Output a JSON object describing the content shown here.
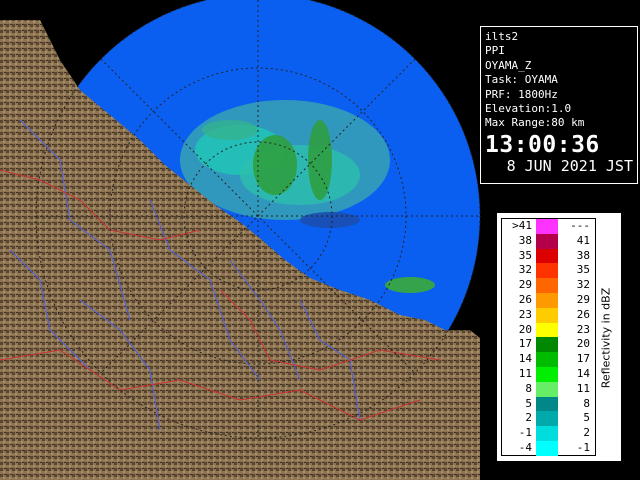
{
  "radar": {
    "site": "ilts2",
    "mode": "PPI",
    "product": "OYAMA_Z",
    "task": "Task: OYAMA",
    "prf": "PRF: 1800Hz",
    "elevation": "Elevation:1.0",
    "max_range": "Max Range:80 km",
    "time": "13:00:36",
    "date": "8 JUN 2021 JST"
  },
  "legend": {
    "unit": "Reflectivity in dBZ",
    "rows": [
      {
        "lo": ">41",
        "hi": "---",
        "color": "#ff33ff"
      },
      {
        "lo": "38",
        "hi": "41",
        "color": "#b4004b"
      },
      {
        "lo": "35",
        "hi": "38",
        "color": "#dd0000"
      },
      {
        "lo": "32",
        "hi": "35",
        "color": "#ff3300"
      },
      {
        "lo": "29",
        "hi": "32",
        "color": "#ff6600"
      },
      {
        "lo": "26",
        "hi": "29",
        "color": "#ff9900"
      },
      {
        "lo": "23",
        "hi": "26",
        "color": "#ffcc00"
      },
      {
        "lo": "20",
        "hi": "23",
        "color": "#ffff00"
      },
      {
        "lo": "17",
        "hi": "20",
        "color": "#008800"
      },
      {
        "lo": "14",
        "hi": "17",
        "color": "#00bb00"
      },
      {
        "lo": "11",
        "hi": "14",
        "color": "#00ee00"
      },
      {
        "lo": "8",
        "hi": "11",
        "color": "#66ee66"
      },
      {
        "lo": "5",
        "hi": "8",
        "color": "#008888"
      },
      {
        "lo": "2",
        "hi": "5",
        "color": "#00aaaa"
      },
      {
        "lo": "-1",
        "hi": "2",
        "color": "#00dddd"
      },
      {
        "lo": "-4",
        "hi": "-1",
        "color": "#00ffff"
      }
    ]
  },
  "colors": {
    "sea": "#0a5ff0",
    "outside": "#000000",
    "land": "#8a7352",
    "rivers": "#4f5fe0",
    "borders": "#cc3333"
  }
}
